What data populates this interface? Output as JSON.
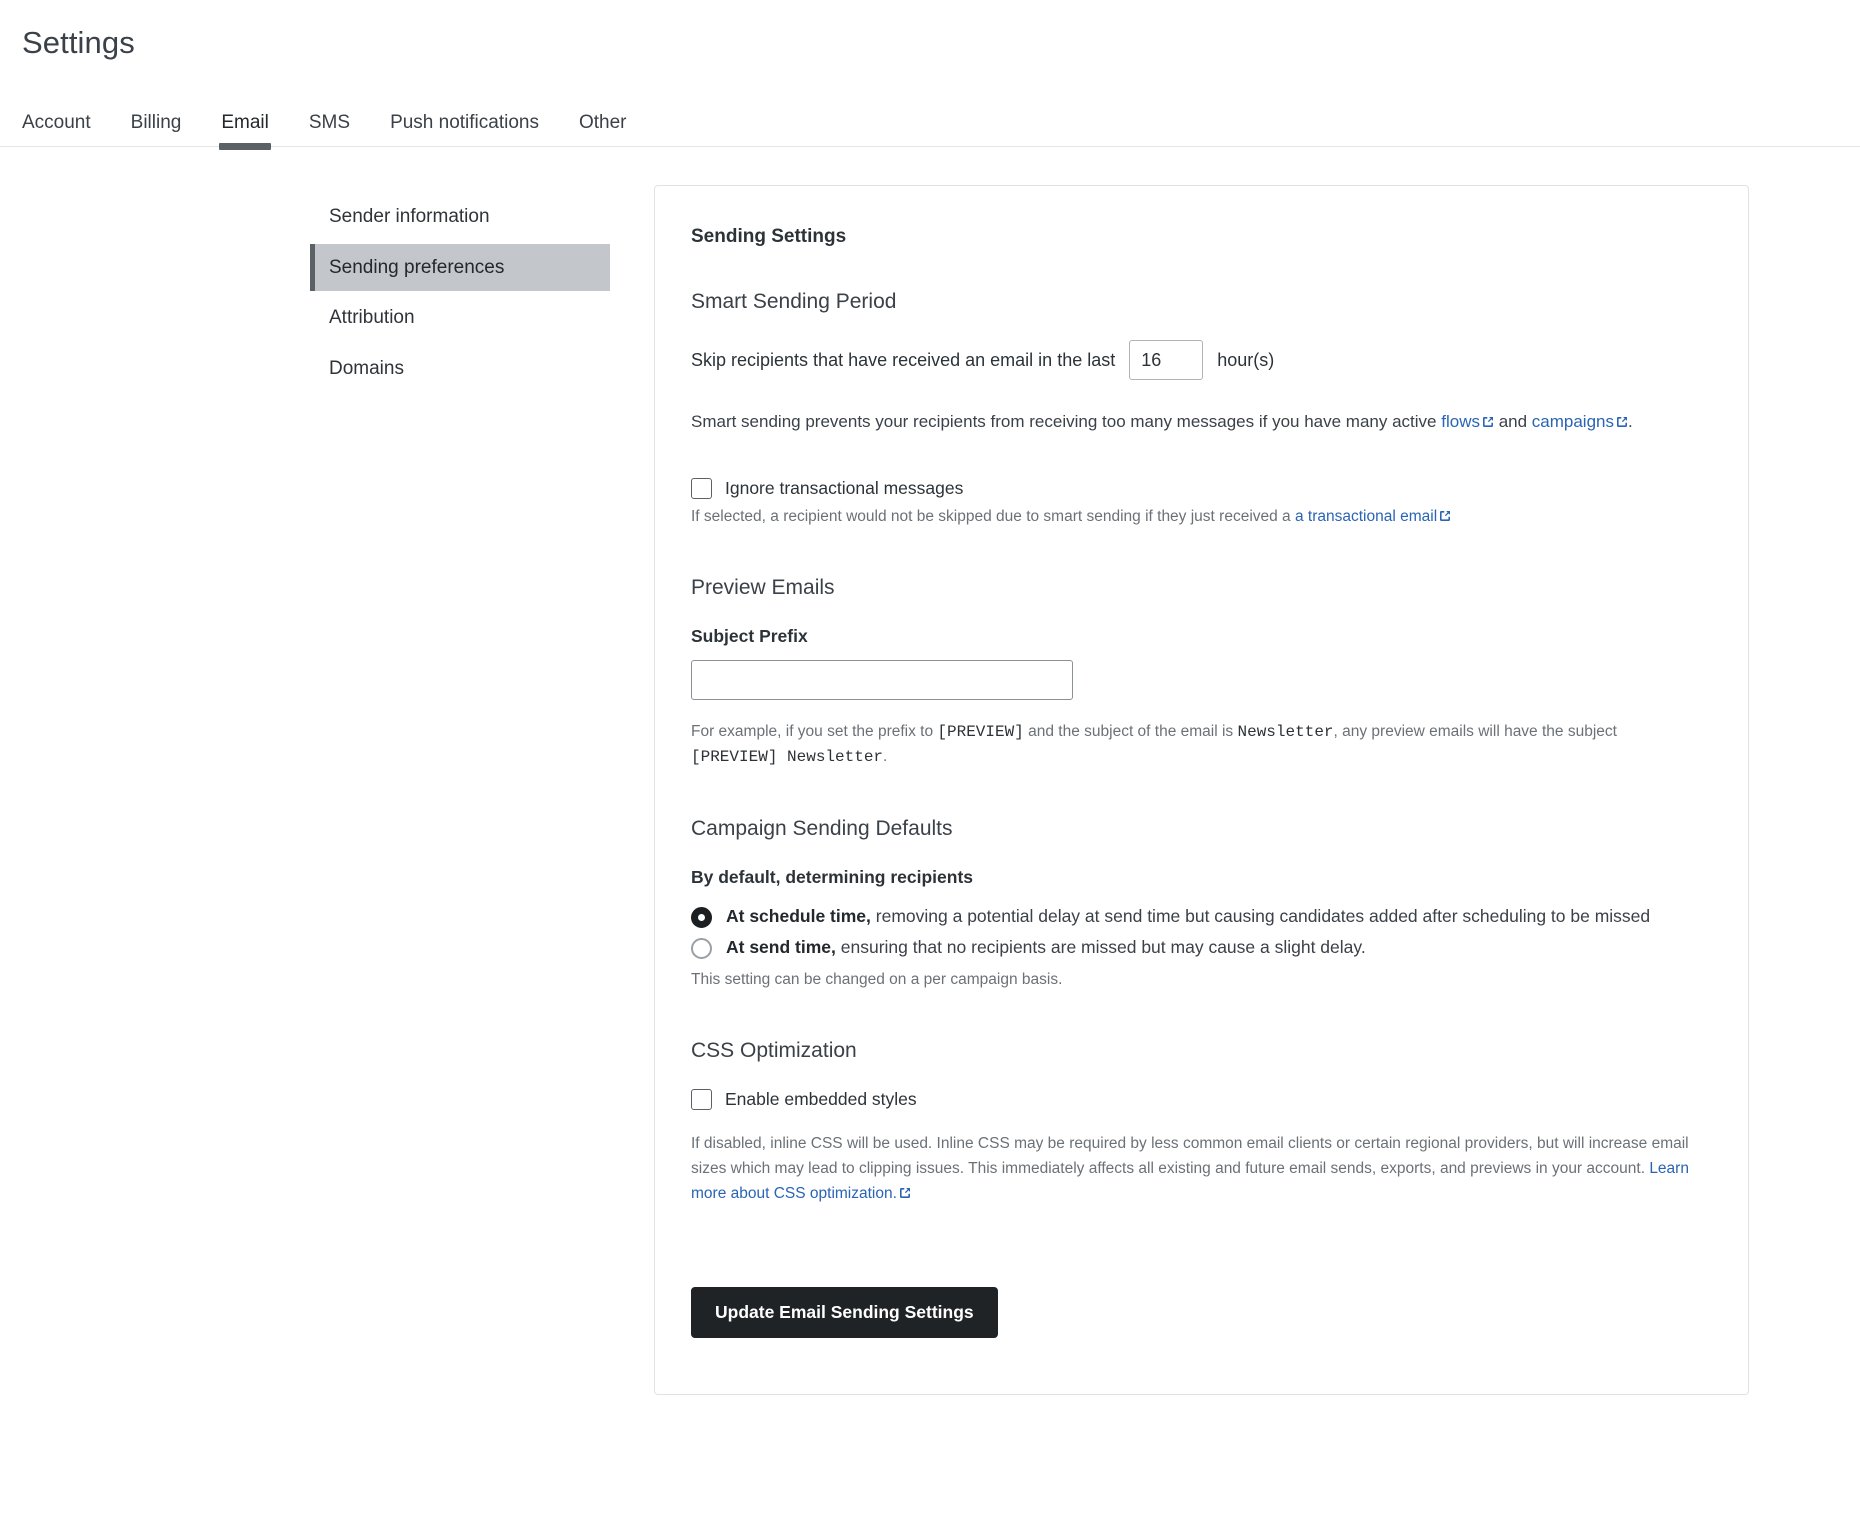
{
  "header": {
    "title": "Settings",
    "tabs": [
      {
        "label": "Account",
        "active": false
      },
      {
        "label": "Billing",
        "active": false
      },
      {
        "label": "Email",
        "active": true
      },
      {
        "label": "SMS",
        "active": false
      },
      {
        "label": "Push notifications",
        "active": false
      },
      {
        "label": "Other",
        "active": false
      }
    ]
  },
  "sidenav": {
    "items": [
      {
        "label": "Sender information",
        "active": false
      },
      {
        "label": "Sending preferences",
        "active": true
      },
      {
        "label": "Attribution",
        "active": false
      },
      {
        "label": "Domains",
        "active": false
      }
    ]
  },
  "card": {
    "title": "Sending Settings",
    "smart_sending": {
      "heading": "Smart Sending Period",
      "skip_prefix": "Skip recipients that have received an email in the last",
      "hours_value": "16",
      "hours_suffix": "hour(s)",
      "desc_part1": "Smart sending prevents your recipients from receiving too many messages if you have many active ",
      "desc_link1": "flows",
      "desc_part2": " and ",
      "desc_link2": "campaigns",
      "desc_part3": ".",
      "ignore_checkbox_label": "Ignore transactional messages",
      "ignore_checkbox_checked": false,
      "ignore_helper_prefix": "If selected, a recipient would not be skipped due to smart sending if they just received a ",
      "ignore_helper_link": "a transactional email"
    },
    "preview_emails": {
      "heading": "Preview Emails",
      "subject_prefix_label": "Subject Prefix",
      "subject_prefix_value": "",
      "subject_prefix_placeholder": "",
      "example_part1": "For example, if you set the prefix to ",
      "example_code1": "[PREVIEW]",
      "example_part2": " and the subject of the email is ",
      "example_code2": "Newsletter",
      "example_part3": ", any preview emails will have the subject ",
      "example_code3": "[PREVIEW] Newsletter",
      "example_part4": "."
    },
    "campaign_defaults": {
      "heading": "Campaign Sending Defaults",
      "sub_label": "By default, determining recipients",
      "options": [
        {
          "bold": "At schedule time,",
          "rest": " removing a potential delay at send time but causing candidates added after scheduling to be missed",
          "selected": true
        },
        {
          "bold": "At send time,",
          "rest": " ensuring that no recipients are missed but may cause a slight delay.",
          "selected": false
        }
      ],
      "helper": "This setting can be changed on a per campaign basis."
    },
    "css_optimization": {
      "heading": "CSS Optimization",
      "checkbox_label": "Enable embedded styles",
      "checkbox_checked": false,
      "desc": "If disabled, inline CSS will be used. Inline CSS may be required by less common email clients or certain regional providers, but will increase email sizes which may lead to clipping issues. This immediately affects all existing and future email sends, exports, and previews in your account. ",
      "desc_link": "Learn more about CSS optimization."
    },
    "submit_label": "Update Email Sending Settings"
  },
  "colors": {
    "link": "#2a64b4",
    "active_sidenav_bg": "#c3c7cb",
    "accent_bar": "#5c6166",
    "button_bg": "#1f2326"
  }
}
